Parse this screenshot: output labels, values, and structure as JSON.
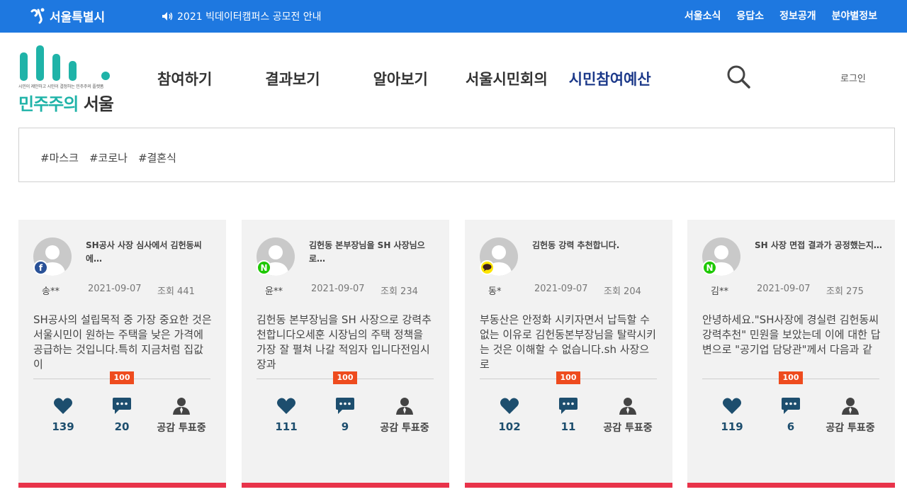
{
  "topbar": {
    "logo_text": "서울특별시",
    "notice": "2021 빅데이터캠퍼스 공모전 안내",
    "links": [
      "서울소식",
      "응답소",
      "정보공개",
      "분야별정보"
    ]
  },
  "brand": {
    "tagline": "시민이 제안하고 시민이 결정하는 민주주의 플랫폼",
    "name_part1": "민주주의",
    "name_part2": "서울",
    "colors": {
      "teal": "#1fb3a8",
      "dark": "#333333"
    }
  },
  "nav": {
    "items": [
      {
        "label": "참여하기",
        "active": false
      },
      {
        "label": "결과보기",
        "active": false
      },
      {
        "label": "알아보기",
        "active": false
      },
      {
        "label": "서울시민회의",
        "active": false
      },
      {
        "label": "시민참여예산",
        "active": true
      }
    ],
    "search_icon": "search-icon",
    "login": "로그인"
  },
  "tags": [
    "#마스크",
    "#코로나",
    "#결혼식"
  ],
  "cards": [
    {
      "title": "SH공사 사장 심사에서 김헌동씨 에…",
      "sns": "facebook",
      "sns_glyph": "f",
      "author": "송**",
      "date": "2021-09-07",
      "views": "조회 441",
      "body": "SH공사의 설립목적 중 가장 중요한 것은 서울시민이 원하는 주택을 낮은 가격에 공급하는 것입니다.특히 지금처럼 집값이",
      "score": "100",
      "likes": "139",
      "comments": "20",
      "vote_label": "공감 투표중"
    },
    {
      "title": "김헌동 본부장님을 SH 사장님으로…",
      "sns": "naver",
      "sns_glyph": "N",
      "author": "윤**",
      "date": "2021-09-07",
      "views": "조회 234",
      "body": "김헌동 본부장님을 SH 사장으로 강력추천합니다오세훈 시장님의 주택 정책을 가장 잘 펼쳐 나갈 적임자 입니다전임시장과",
      "score": "100",
      "likes": "111",
      "comments": "9",
      "vote_label": "공감 투표중"
    },
    {
      "title": "김헌동 강력 추천합니다.",
      "sns": "kakao",
      "sns_glyph": "💬",
      "author": "동*",
      "date": "2021-09-07",
      "views": "조회 204",
      "body": "부동산은 안정화 시키자면서 납득할 수 없는 이유로 김헌동본부장님을 탈락시키는 것은 이해할 수 없습니다.sh 사장으로",
      "score": "100",
      "likes": "102",
      "comments": "11",
      "vote_label": "공감 투표중"
    },
    {
      "title": "SH 사장 면접 결과가 공정했는지…",
      "sns": "naver",
      "sns_glyph": "N",
      "author": "김**",
      "date": "2021-09-07",
      "views": "조회 275",
      "body": "안녕하세요.\"SH사장에 경실련 김헌동씨 강력추천\" 민원을 보았는데 이에 대한 답변으로 \"공기업 담당관\"께서 다음과 같",
      "score": "100",
      "likes": "119",
      "comments": "6",
      "vote_label": "공감 투표중"
    }
  ],
  "colors": {
    "topbar": "#1e78e0",
    "nav_active": "#1d3a8a",
    "card_bg": "#f2f2f2",
    "card_bar": "#e8334a",
    "score_badge": "#ee4b1e",
    "stat_icon": "#1d4e6e"
  }
}
